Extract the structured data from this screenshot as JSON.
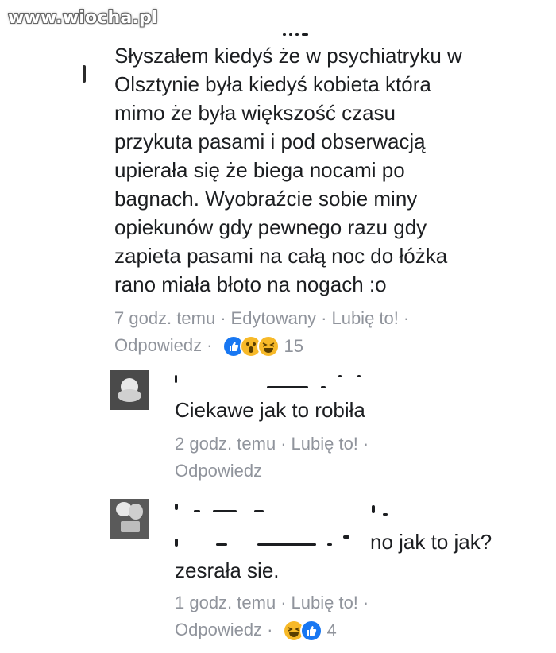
{
  "watermark": "www.wiocha.pl",
  "main_comment": {
    "text": "Słyszałem kiedyś że w psychiatryku w\nOlsztynie była kiedyś kobieta która\nmimo że była większość czasu\nprzykuta pasami i pod obserwacją\nupierała się że biega nocami po\nbagnach. Wyobraźcie sobie miny\nopiekunów gdy pewnego razu gdy\nzapieta pasami na całą noc do łóżka\nrano miała błoto na nogach :o",
    "time": "7 godz. temu",
    "edited": "Edytowany",
    "like": "Lubię to!",
    "reply": "Odpowiedz",
    "reaction_count": "15",
    "reactions": [
      "like-icon",
      "wow-icon",
      "haha-icon"
    ]
  },
  "replies": [
    {
      "text": "Ciekawe jak to robiła",
      "time": "2 godz. temu",
      "like": "Lubię to!",
      "reply": "Odpowiedz",
      "reaction_count": "",
      "reactions": []
    },
    {
      "text_tail": "no jak to jak?",
      "text2": "zesrała sie.",
      "time": "1 godz. temu",
      "like": "Lubię to!",
      "reply": "Odpowiedz",
      "reaction_count": "4",
      "reactions": [
        "haha-icon",
        "like-icon"
      ]
    }
  ],
  "colors": {
    "text": "#1c1e21",
    "meta": "#90949c",
    "like_blue": "#1877f2",
    "emoji_yellow": "#f7b928"
  }
}
